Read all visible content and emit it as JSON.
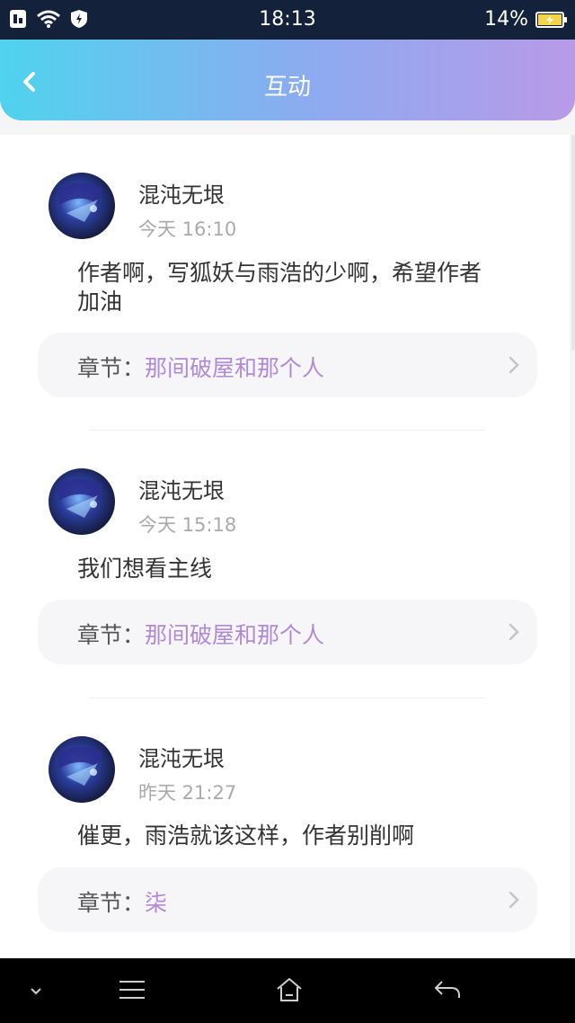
{
  "status_bar": {
    "time": "18:13",
    "battery": "14%"
  },
  "header": {
    "title": "互动"
  },
  "colors": {
    "accent_purple": "#b18ad6",
    "header_gradient_start": "#4fd3ee",
    "header_gradient_end": "#b89ae8"
  },
  "comments": [
    {
      "username": "混沌无垠",
      "time": "今天 16:10",
      "text_line1": "作者啊，写狐妖与雨浩的少啊，希望作者",
      "text_line2": "加油",
      "chapter_label": "章节：",
      "chapter_name": "那间破屋和那个人"
    },
    {
      "username": "混沌无垠",
      "time": "今天 15:18",
      "text_line1": "我们想看主线",
      "chapter_label": "章节：",
      "chapter_name": "那间破屋和那个人"
    },
    {
      "username": "混沌无垠",
      "time": "昨天 21:27",
      "text_line1": "催更，雨浩就该这样，作者别削啊",
      "chapter_label": "章节：",
      "chapter_name": "柒"
    }
  ],
  "icons": [
    "sim-icon",
    "wifi-icon",
    "shield-icon",
    "battery-icon",
    "back-arrow-icon",
    "chevron-right-icon",
    "chevron-down-icon",
    "menu-icon",
    "home-icon",
    "return-icon"
  ]
}
